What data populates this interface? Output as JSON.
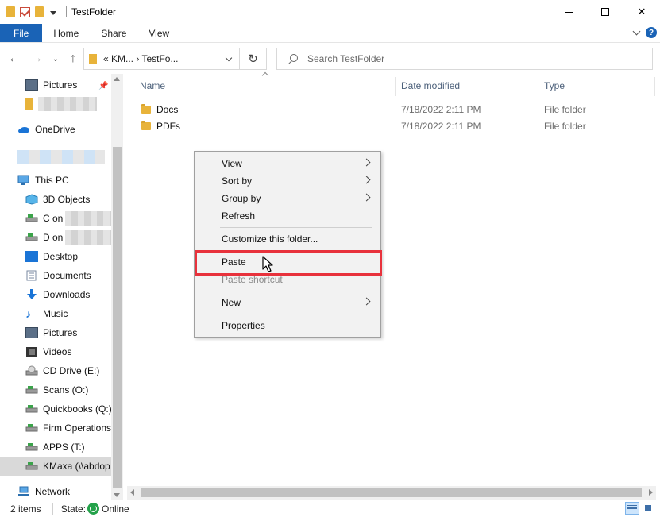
{
  "window": {
    "title": "TestFolder",
    "controls": {
      "minimize": "minimize",
      "maximize": "maximize",
      "close": "✕"
    }
  },
  "ribbon": {
    "tabs": [
      "File",
      "Home",
      "Share",
      "View"
    ]
  },
  "address": {
    "path_text": "«  KM...  ›  TestFo...",
    "search_placeholder": "Search TestFolder"
  },
  "nav": {
    "items": [
      {
        "label": "Pictures",
        "icon": "pictures-icon"
      },
      {
        "label": "",
        "icon": "folder-icon"
      },
      {
        "label": "OneDrive",
        "icon": "onedrive-icon"
      },
      {
        "label": "",
        "icon": "user-icon"
      },
      {
        "label": "This PC",
        "icon": "computer-icon"
      },
      {
        "label": "3D Objects",
        "icon": "3d-objects-icon"
      },
      {
        "label": "C on",
        "icon": "network-drive-icon"
      },
      {
        "label": "D on",
        "icon": "network-drive-icon"
      },
      {
        "label": "Desktop",
        "icon": "desktop-icon"
      },
      {
        "label": "Documents",
        "icon": "documents-icon"
      },
      {
        "label": "Downloads",
        "icon": "downloads-icon"
      },
      {
        "label": "Music",
        "icon": "music-icon"
      },
      {
        "label": "Pictures",
        "icon": "pictures-icon"
      },
      {
        "label": "Videos",
        "icon": "videos-icon"
      },
      {
        "label": "CD Drive (E:)",
        "icon": "cd-drive-icon"
      },
      {
        "label": "Scans (O:)",
        "icon": "network-drive-icon"
      },
      {
        "label": "Quickbooks (Q:)",
        "icon": "network-drive-icon"
      },
      {
        "label": "Firm Operations",
        "icon": "network-drive-icon"
      },
      {
        "label": "APPS (T:)",
        "icon": "network-drive-icon"
      },
      {
        "label": "KMaxa (\\\\abdop",
        "icon": "network-drive-icon"
      },
      {
        "label": "Network",
        "icon": "network-icon"
      }
    ]
  },
  "files": {
    "columns": {
      "name": "Name",
      "date": "Date modified",
      "type": "Type"
    },
    "rows": [
      {
        "name": "Docs",
        "date": "7/18/2022 2:11 PM",
        "type": "File folder"
      },
      {
        "name": "PDFs",
        "date": "7/18/2022 2:11 PM",
        "type": "File folder"
      }
    ]
  },
  "context_menu": {
    "items": [
      {
        "label": "View",
        "submenu": true
      },
      {
        "label": "Sort by",
        "submenu": true
      },
      {
        "label": "Group by",
        "submenu": true
      },
      {
        "label": "Refresh"
      },
      {
        "label": "Customize this folder..."
      },
      {
        "label": "Paste",
        "highlighted": true
      },
      {
        "label": "Paste shortcut",
        "disabled": true
      },
      {
        "label": "New",
        "submenu": true
      },
      {
        "label": "Properties"
      }
    ]
  },
  "status": {
    "count": "2 items",
    "state_label": "State:",
    "state_value": "Online"
  },
  "colors": {
    "file_tab": "#1a63b6",
    "highlight_box": "#e8323c",
    "folder": "#e8b33a",
    "online": "#24a24a"
  }
}
